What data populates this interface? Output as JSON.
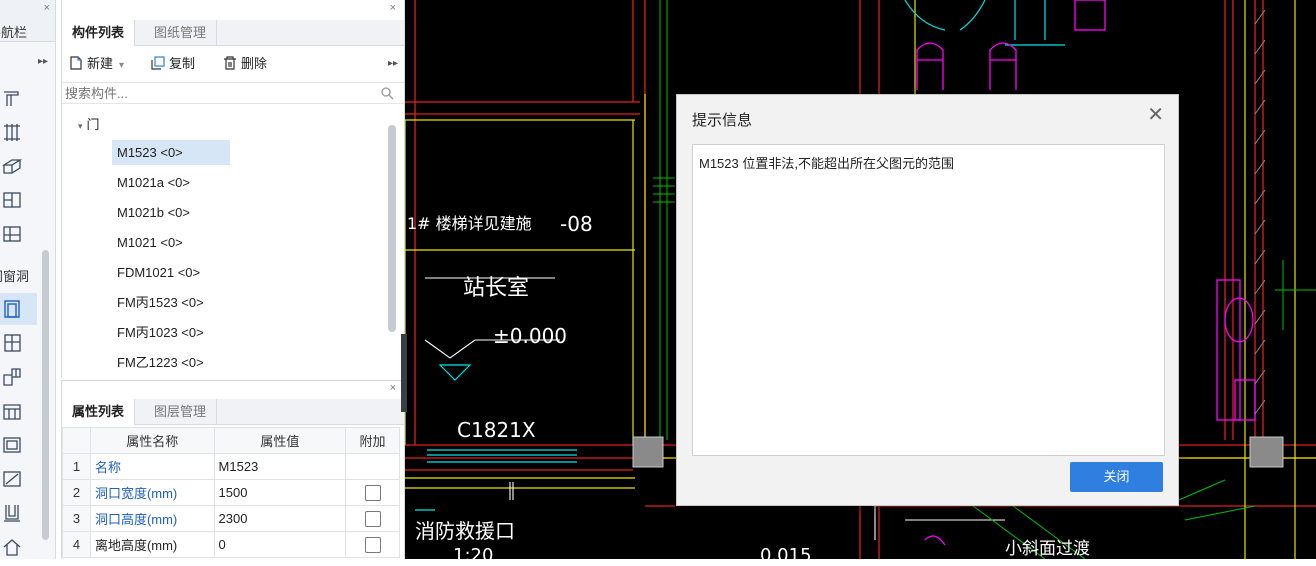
{
  "nav": {
    "title": "导航栏",
    "close_glyph": "×",
    "expand_glyph": "▸▸",
    "section_label": "门窗洞",
    "icons": [
      "wall-icon",
      "grid-icon",
      "beam-icon",
      "slab-icon",
      "column-icon",
      "door-icon",
      "window-icon",
      "door-window-icon",
      "wall-hole-icon",
      "bay-window-icon",
      "opening-icon",
      "niche-icon",
      "lintel-icon",
      "house-icon"
    ]
  },
  "component_panel": {
    "close_glyph": "×",
    "tabs": [
      {
        "label": "构件列表",
        "active": true
      },
      {
        "label": "图纸管理",
        "active": false
      }
    ],
    "toolbar": {
      "new_label": "新建",
      "copy_label": "复制",
      "delete_label": "删除",
      "more_glyph": "▸▸"
    },
    "search": {
      "placeholder": "搜索构件..."
    },
    "tree": {
      "group_label": "门",
      "items": [
        {
          "label": "M1523 <0>",
          "selected": true
        },
        {
          "label": "M1021a <0>",
          "selected": false
        },
        {
          "label": "M1021b <0>",
          "selected": false
        },
        {
          "label": "M1021 <0>",
          "selected": false
        },
        {
          "label": "FDM1021 <0>",
          "selected": false
        },
        {
          "label": "FM丙1523 <0>",
          "selected": false
        },
        {
          "label": "FM丙1023 <0>",
          "selected": false
        },
        {
          "label": "FM乙1223 <0>",
          "selected": false
        }
      ]
    }
  },
  "property_panel": {
    "close_glyph": "×",
    "tabs": [
      {
        "label": "属性列表",
        "active": true
      },
      {
        "label": "图层管理",
        "active": false
      }
    ],
    "columns": [
      "属性名称",
      "属性值",
      "附加"
    ],
    "rows": [
      {
        "num": "1",
        "name": "名称",
        "value": "M1523",
        "checkbox": false,
        "blue": true
      },
      {
        "num": "2",
        "name": "洞口宽度(mm)",
        "value": "1500",
        "checkbox": true,
        "blue": true
      },
      {
        "num": "3",
        "name": "洞口高度(mm)",
        "value": "2300",
        "checkbox": true,
        "blue": true
      },
      {
        "num": "4",
        "name": "离地高度(mm)",
        "value": "0",
        "checkbox": true,
        "blue": false
      }
    ]
  },
  "cad": {
    "texts": {
      "stair_note": "1# 楼梯详见建施",
      "stair_suffix": "-08",
      "room": "站长室",
      "elevation": "±0.000",
      "window_tag": "C1821X",
      "rescue_port": "消防救援口",
      "scale": "1:20",
      "slope_value": "0.015",
      "slope_note": "小斜面过渡"
    },
    "colors": {
      "background": "#000000",
      "wall_red": "#e02020",
      "axis_yellow": "#e6e600",
      "fixture_magenta": "#ff00ff",
      "door_cyan": "#00e5e5",
      "hatch_gray": "#8a8a8a",
      "line_green": "#00c000"
    }
  },
  "dialog": {
    "title": "提示信息",
    "close_glyph": "✕",
    "message": "M1523 位置非法,不能超出所在父图元的范围",
    "button_label": "关闭",
    "accent": "#2f7fe0"
  }
}
